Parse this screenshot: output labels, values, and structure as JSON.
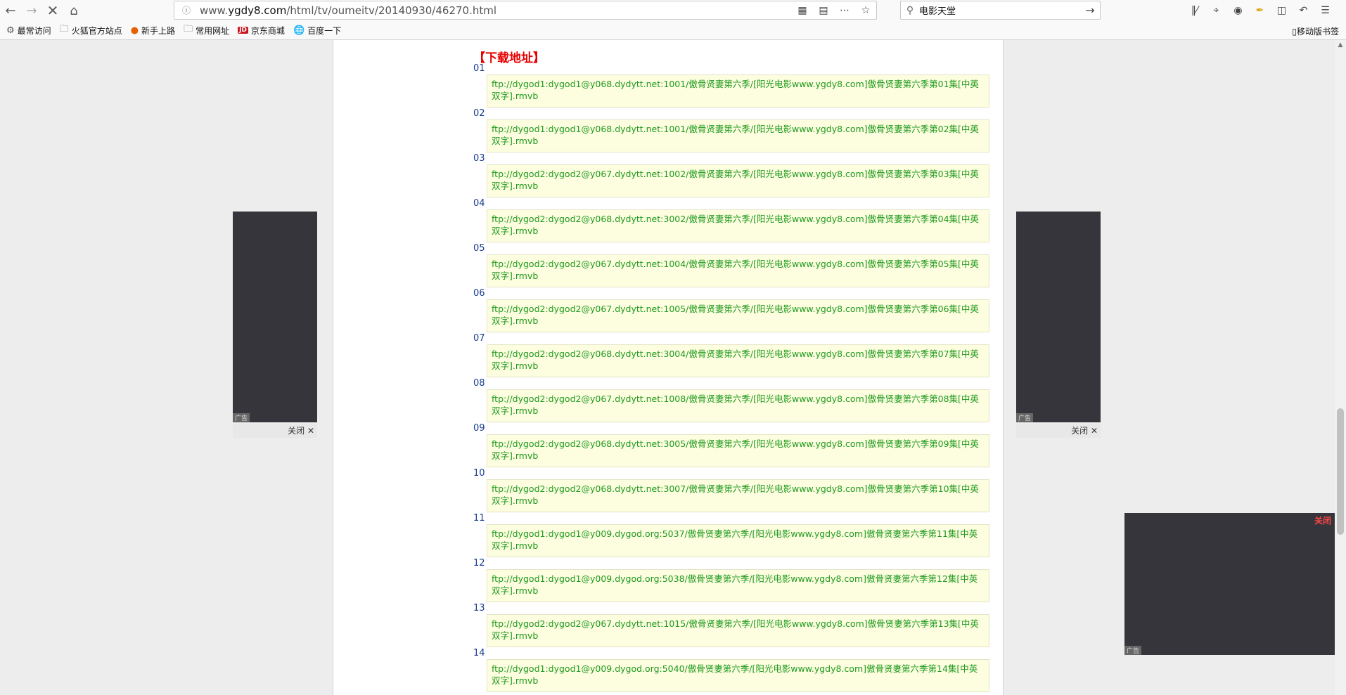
{
  "toolbar": {
    "url_prefix": "www.",
    "url_domain": "ygdy8.com",
    "url_path": "/html/tv/oumeitv/20140930/46270.html",
    "search_value": "电影天堂"
  },
  "bookmarks": [
    {
      "label": "最常访问",
      "icon": "gear-icon"
    },
    {
      "label": "火狐官方站点",
      "icon": "folder-icon"
    },
    {
      "label": "新手上路",
      "icon": "firefox-icon"
    },
    {
      "label": "常用网址",
      "icon": "folder-icon"
    },
    {
      "label": "京东商城",
      "icon": "jd-icon"
    },
    {
      "label": "百度一下",
      "icon": "globe-icon"
    }
  ],
  "bookmark_mobile": "移动版书签",
  "page": {
    "download_title": "【下载地址】",
    "episodes": [
      {
        "num": "01",
        "link": "ftp://dygod1:dygod1@y068.dydytt.net:1001/傲骨贤妻第六季/[阳光电影www.ygdy8.com]傲骨贤妻第六季第01集[中英双字].rmvb"
      },
      {
        "num": "02",
        "link": "ftp://dygod1:dygod1@y068.dydytt.net:1001/傲骨贤妻第六季/[阳光电影www.ygdy8.com]傲骨贤妻第六季第02集[中英双字].rmvb"
      },
      {
        "num": "03",
        "link": "ftp://dygod2:dygod2@y067.dydytt.net:1002/傲骨贤妻第六季/[阳光电影www.ygdy8.com]傲骨贤妻第六季第03集[中英双字].rmvb"
      },
      {
        "num": "04",
        "link": "ftp://dygod2:dygod2@y068.dydytt.net:3002/傲骨贤妻第六季/[阳光电影www.ygdy8.com]傲骨贤妻第六季第04集[中英双字].rmvb"
      },
      {
        "num": "05",
        "link": "ftp://dygod2:dygod2@y067.dydytt.net:1004/傲骨贤妻第六季/[阳光电影www.ygdy8.com]傲骨贤妻第六季第05集[中英双字].rmvb"
      },
      {
        "num": "06",
        "link": "ftp://dygod2:dygod2@y067.dydytt.net:1005/傲骨贤妻第六季/[阳光电影www.ygdy8.com]傲骨贤妻第六季第06集[中英双字].rmvb"
      },
      {
        "num": "07",
        "link": "ftp://dygod2:dygod2@y068.dydytt.net:3004/傲骨贤妻第六季/[阳光电影www.ygdy8.com]傲骨贤妻第六季第07集[中英双字].rmvb"
      },
      {
        "num": "08",
        "link": "ftp://dygod2:dygod2@y067.dydytt.net:1008/傲骨贤妻第六季/[阳光电影www.ygdy8.com]傲骨贤妻第六季第08集[中英双字].rmvb"
      },
      {
        "num": "09",
        "link": "ftp://dygod2:dygod2@y068.dydytt.net:3005/傲骨贤妻第六季/[阳光电影www.ygdy8.com]傲骨贤妻第六季第09集[中英双字].rmvb"
      },
      {
        "num": "10",
        "link": "ftp://dygod2:dygod2@y068.dydytt.net:3007/傲骨贤妻第六季/[阳光电影www.ygdy8.com]傲骨贤妻第六季第10集[中英双字].rmvb"
      },
      {
        "num": "11",
        "link": "ftp://dygod1:dygod1@y009.dygod.org:5037/傲骨贤妻第六季/[阳光电影www.ygdy8.com]傲骨贤妻第六季第11集[中英双字].rmvb"
      },
      {
        "num": "12",
        "link": "ftp://dygod1:dygod1@y009.dygod.org:5038/傲骨贤妻第六季/[阳光电影www.ygdy8.com]傲骨贤妻第六季第12集[中英双字].rmvb"
      },
      {
        "num": "13",
        "link": "ftp://dygod2:dygod2@y067.dydytt.net:1015/傲骨贤妻第六季/[阳光电影www.ygdy8.com]傲骨贤妻第六季第13集[中英双字].rmvb"
      },
      {
        "num": "14",
        "link": "ftp://dygod1:dygod1@y009.dygod.org:5040/傲骨贤妻第六季/[阳光电影www.ygdy8.com]傲骨贤妻第六季第14集[中英双字].rmvb"
      }
    ]
  },
  "ads": {
    "tag": "广告",
    "close": "关闭",
    "corner_close": "关闭"
  },
  "colors": {
    "title_red": "#e60000",
    "link_green": "#1e9a1e",
    "box_bg": "#fdfddf",
    "ad_dark": "#35353b"
  }
}
